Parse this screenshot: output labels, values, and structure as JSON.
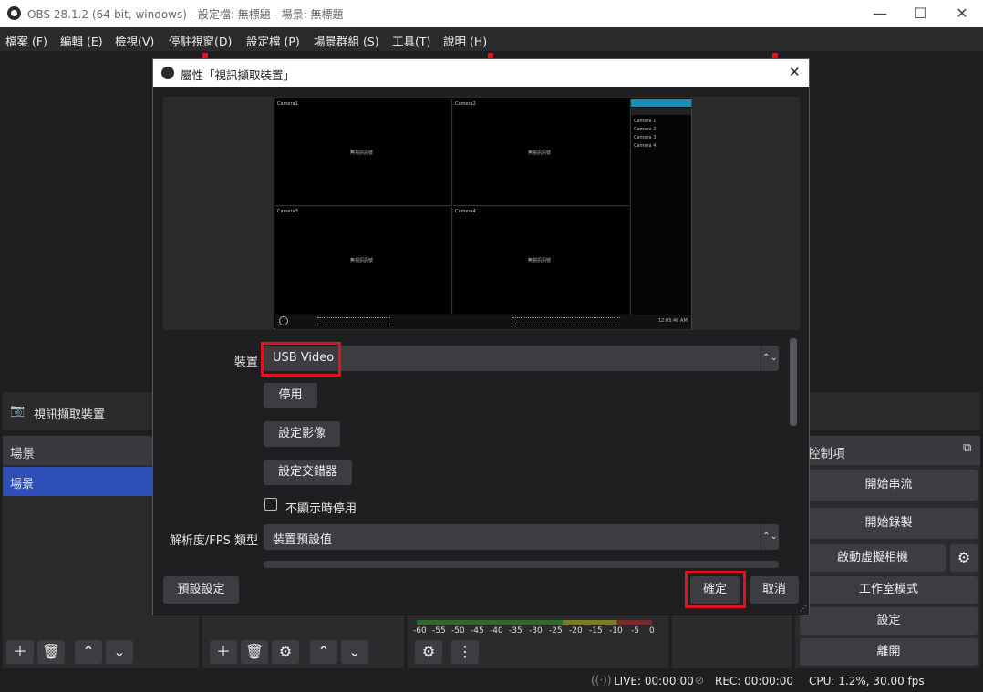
{
  "window": {
    "title": "OBS 28.1.2 (64-bit, windows) - 設定檔: 無標題 - 場景: 無標題",
    "minimize": "—",
    "maximize": "☐",
    "close": "✕"
  },
  "menubar": [
    "檔案 (F)",
    "編輯 (E)",
    "檢視(V)",
    "停駐視窗(D)",
    "設定檔 (P)",
    "場景群組 (S)",
    "工具(T)",
    "說明 (H)"
  ],
  "source_bar": {
    "label": "視訊擷取裝置"
  },
  "scenes": {
    "header": "場景",
    "items": [
      "場景"
    ]
  },
  "controls": {
    "header": "控制項",
    "start_stream": "開始串流",
    "start_record": "開始錄製",
    "virtual_cam": "啟動虛擬相機",
    "studio_mode": "工作室模式",
    "settings": "設定",
    "exit": "離開"
  },
  "mixer": {
    "ticks": [
      "-60",
      "-55",
      "-50",
      "-45",
      "-40",
      "-35",
      "-30",
      "-25",
      "-20",
      "-15",
      "-10",
      "-5",
      "0"
    ]
  },
  "statusbar": {
    "live": "LIVE: 00:00:00",
    "rec": "REC: 00:00:00",
    "cpu": "CPU: 1.2%, 30.00 fps"
  },
  "dialog": {
    "title": "屬性「視訊擷取裝置」",
    "device_label": "裝置",
    "device_value": "USB Video",
    "deactivate": "停用",
    "configure_video": "設定影像",
    "configure_crossbar": "設定交錯器",
    "hide_when_inactive": "不顯示時停用",
    "resolution_label": "解析度/FPS 類型",
    "resolution_value": "裝置預設值",
    "defaults": "預設設定",
    "ok": "確定",
    "cancel": "取消",
    "close": "✕",
    "preview": {
      "cameras": [
        "Camera1",
        "Camera2",
        "Camera3",
        "Camera4"
      ],
      "no_signal": "無視訊訊號",
      "sidebar_items": [
        "Camera 1",
        "Camera 2",
        "Camera 3",
        "Camera 4"
      ],
      "clock": "12:05:46 AM"
    }
  },
  "colors": {
    "accent_red": "#e0141e",
    "scene_selected": "#2f4fb8"
  }
}
